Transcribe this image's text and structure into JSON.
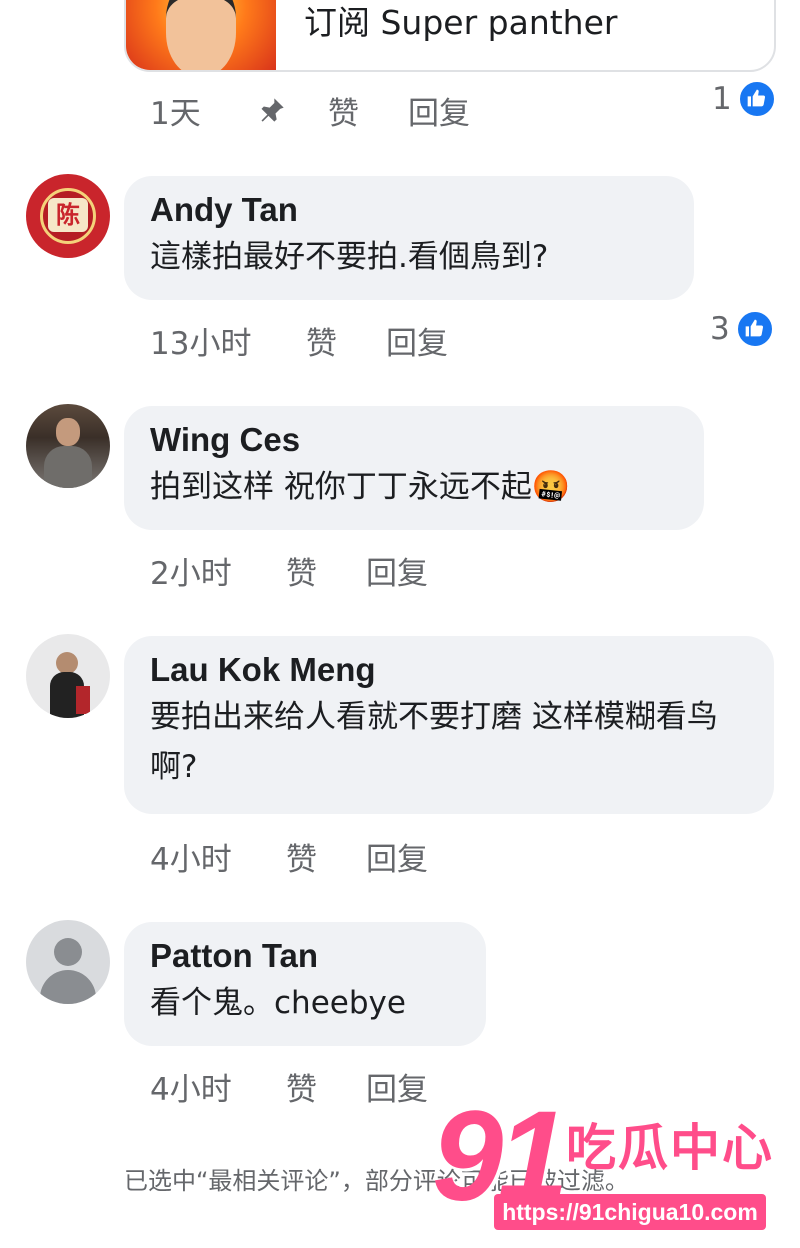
{
  "top_card": {
    "title": "订阅 Super panther"
  },
  "pinned_comment_meta": {
    "time": "1天",
    "like_label": "赞",
    "reply_label": "回复",
    "reaction_count": "1"
  },
  "comments": [
    {
      "author": "Andy Tan",
      "text": "這樣拍最好不要拍.看個鳥到?",
      "time": "13小时",
      "like_label": "赞",
      "reply_label": "回复",
      "reaction_count": "3"
    },
    {
      "author": "Wing Ces",
      "text": "拍到这样 祝你丁丁永远不起",
      "emoji": "🤬",
      "time": "2小时",
      "like_label": "赞",
      "reply_label": "回复"
    },
    {
      "author": "Lau Kok Meng",
      "text": "要拍出来给人看就不要打磨 这样模糊看鸟啊?",
      "time": "4小时",
      "like_label": "赞",
      "reply_label": "回复"
    },
    {
      "author": "Patton Tan",
      "text": "看个鬼。cheebye",
      "time": "4小时",
      "like_label": "赞",
      "reply_label": "回复"
    }
  ],
  "footer_note": "已选中“最相关评论”，部分评论可能已被过滤。",
  "watermark": {
    "number": "91",
    "name": "吃瓜中心",
    "url": "https://91chigua10.com"
  },
  "avatar_badge_text": "陈",
  "colors": {
    "like_blue": "#1877f2",
    "bubble_bg": "#f0f2f5",
    "meta_gray": "#65676b",
    "watermark_pink": "#ff4d8a"
  }
}
